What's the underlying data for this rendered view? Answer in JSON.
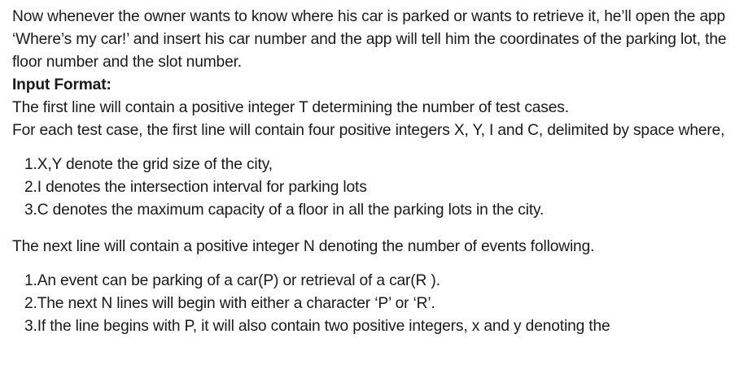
{
  "document": {
    "intro_paragraph": "Now whenever the owner wants to know where his car is parked or wants to retrieve it, he’ll open the app ‘Where’s my car!’ and insert his car number and the app will tell him the coordinates of the parking lot, the floor number and the slot number.",
    "input_format_heading": "Input Format:",
    "first_line_text": "The first line will contain a positive integer T determining the number of test cases.",
    "each_test_case_text": "For each test case, the first line will contain four positive integers X, Y, I and C, delimited by space where,",
    "params_list": [
      "1.X,Y denote the grid size of the city,",
      "2.I denotes the intersection interval for parking lots",
      "3.C denotes the maximum capacity of a floor in all the parking lots in the city."
    ],
    "next_line_text": "The next line will contain a positive integer N denoting the number of events following.",
    "events_list": [
      "1.An event can be parking of a car(P) or retrieval of a car(R ).",
      "2.The next N lines will begin with either a character ‘P’ or ‘R’.",
      "3.If the line begins with P, it will also contain two positive integers, x and y denoting the"
    ]
  }
}
